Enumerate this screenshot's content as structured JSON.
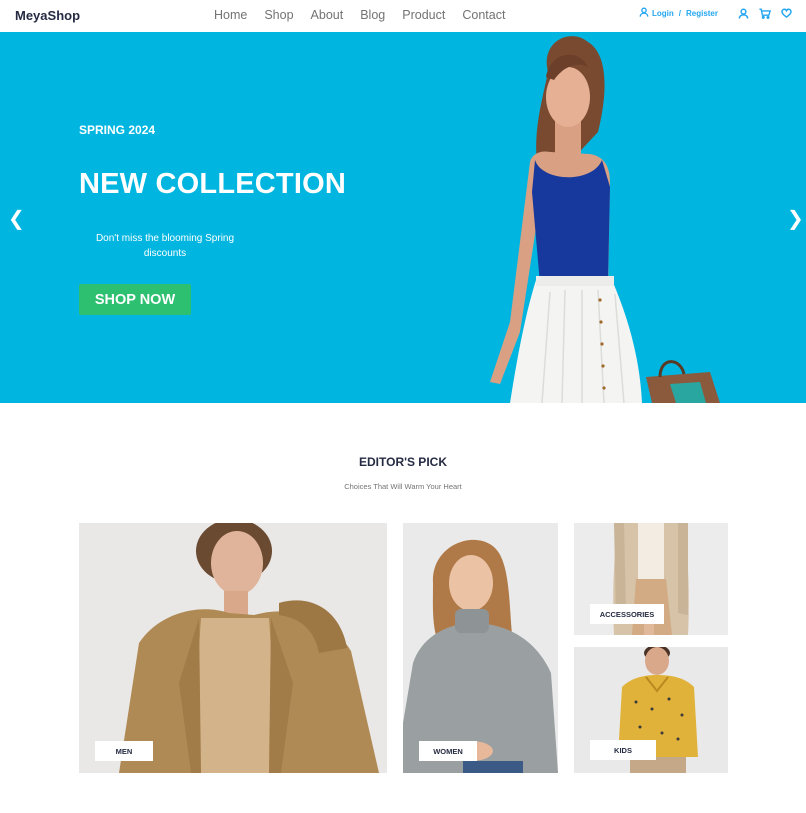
{
  "brand": "MeyaShop",
  "nav": {
    "links": [
      "Home",
      "Shop",
      "About",
      "Blog",
      "Product",
      "Contact"
    ],
    "login": "Login",
    "separator": "/",
    "register": "Register",
    "icons": [
      "user-icon",
      "search-icon",
      "cart-icon",
      "heart-icon"
    ]
  },
  "hero": {
    "season": "SPRING 2024",
    "title": "NEW COLLECTION",
    "description": "Don't miss the blooming Spring discounts",
    "cta": "SHOP NOW",
    "prev": "❮",
    "next": "❯",
    "background_color": "#00b6e0",
    "cta_color": "#2dc071"
  },
  "editors_pick": {
    "title": "EDITOR'S PICK",
    "subtitle": "Choices That Will Warm Your Heart",
    "cards": {
      "men": "MEN",
      "women": "WOMEN",
      "accessories": "ACCESSORIES",
      "kids": "KIDS"
    }
  }
}
